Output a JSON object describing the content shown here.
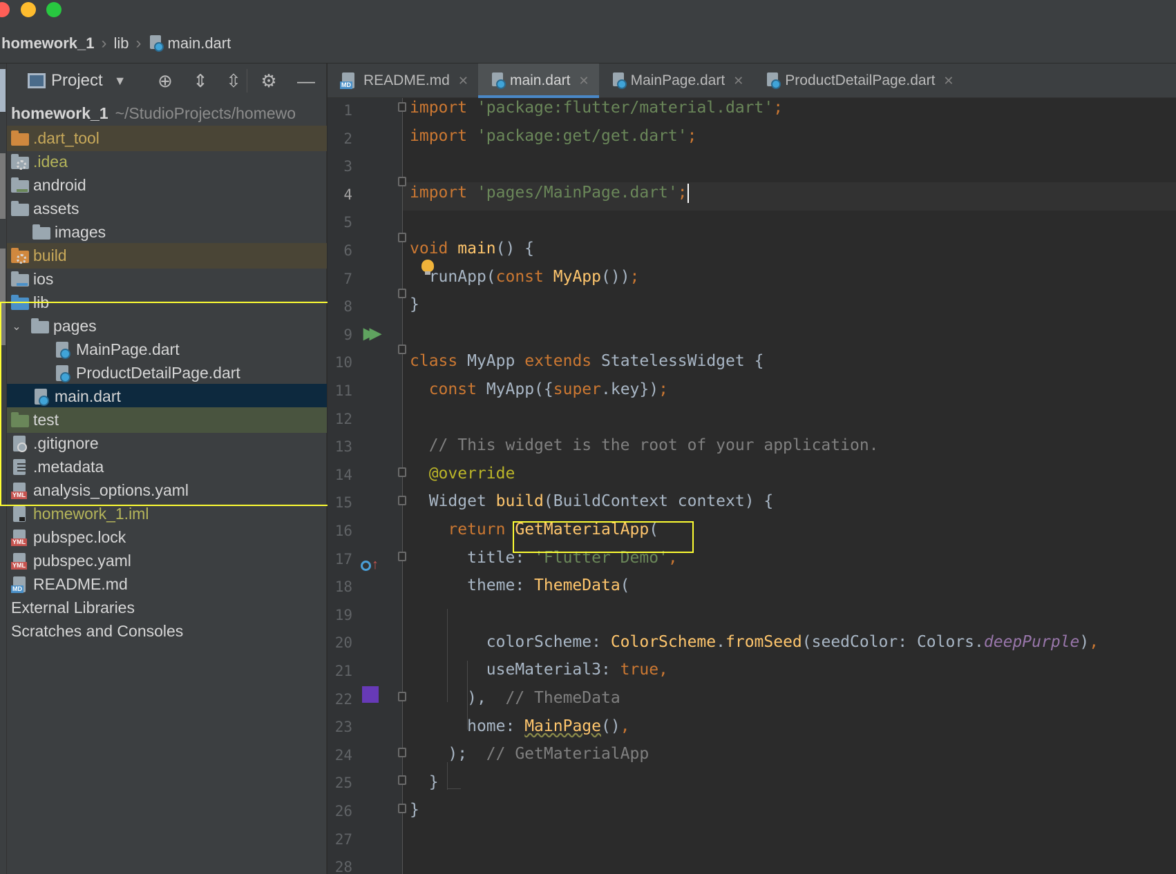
{
  "breadcrumb": {
    "project": "homework_1",
    "folder": "lib",
    "file": "main.dart"
  },
  "project_panel": {
    "title": "Project",
    "root_name": "homework_1",
    "root_path": "~/StudioProjects/homewo",
    "items": {
      "dart_tool": ".dart_tool",
      "idea": ".idea",
      "android": "android",
      "assets": "assets",
      "images": "images",
      "build": "build",
      "ios": "ios",
      "lib": "lib",
      "pages": "pages",
      "mainpage": "MainPage.dart",
      "productdetail": "ProductDetailPage.dart",
      "main": "main.dart",
      "test": "test",
      "gitignore": ".gitignore",
      "metadata": ".metadata",
      "analysis": "analysis_options.yaml",
      "iml": "homework_1.iml",
      "pubspec_lock": "pubspec.lock",
      "pubspec_yaml": "pubspec.yaml",
      "readme": "README.md",
      "external": "External Libraries",
      "scratches": "Scratches and Consoles"
    }
  },
  "tabs": [
    {
      "label": "README.md",
      "icon": "markdown-file-icon"
    },
    {
      "label": "main.dart",
      "icon": "dart-file-icon",
      "active": true
    },
    {
      "label": "MainPage.dart",
      "icon": "dart-file-icon"
    },
    {
      "label": "ProductDetailPage.dart",
      "icon": "dart-file-icon"
    }
  ],
  "editor": {
    "current_line": 4,
    "line_numbers": [
      "1",
      "2",
      "3",
      "4",
      "5",
      "6",
      "7",
      "8",
      "9",
      "10",
      "11",
      "12",
      "13",
      "14",
      "15",
      "16",
      "17",
      "18",
      "19",
      "20",
      "21",
      "22",
      "23",
      "24",
      "25",
      "26",
      "27",
      "28"
    ],
    "code": {
      "l1_kw": "import",
      "l1_str": "'package:flutter/material.dart'",
      "l1_semi": ";",
      "l2_kw": "import",
      "l2_str": "'package:get/get.dart'",
      "l2_semi": ";",
      "l4_kw": "import",
      "l4_str": "'pages/MainPage.dart'",
      "l4_semi": ";",
      "l6_kw": "void",
      "l6_fn": "main",
      "l6_rest": "() {",
      "l7_a": "runApp(",
      "l7_kw": "const",
      "l7_fn": "MyApp",
      "l7_b": "())",
      "l7_semi": ";",
      "l8": "}",
      "l10_kw1": "class",
      "l10_a": "MyApp",
      "l10_kw2": "extends",
      "l10_b": "StatelessWidget {",
      "l11_kw": "const",
      "l11_a": "MyApp({",
      "l11_kw2": "super",
      "l11_b": ".key})",
      "l11_semi": ";",
      "l13": "// This widget is the root of your application.",
      "l14": "@override",
      "l15_a": "Widget",
      "l15_fn": "build",
      "l15_b": "(BuildContext context) {",
      "l16_kw": "return",
      "l16_fn": "GetMaterialApp",
      "l16_b": "(",
      "l17_a": "title:",
      "l17_str": "'Flutter Demo'",
      "l17_comma": ",",
      "l18_a": "theme:",
      "l18_fn": "ThemeData",
      "l18_b": "(",
      "l20_a": "colorScheme:",
      "l20_fn1": "ColorScheme",
      "l20_dot": ".",
      "l20_fn2": "fromSeed",
      "l20_b": "(seedColor: Colors.",
      "l20_pur": "deepPurple",
      "l20_c": ")",
      "l20_comma": ",",
      "l21_a": "useMaterial3:",
      "l21_kw": "true",
      "l21_comma": ",",
      "l22_a": "),",
      "l22_cm": "// ThemeData",
      "l23_a": "home:",
      "l23_fn": "MainPage",
      "l23_b": "()",
      "l23_comma": ",",
      "l24_a": ");",
      "l24_cm": "// GetMaterialApp",
      "l25": "}",
      "l26": "}"
    },
    "swatch_color": "#673ab7"
  },
  "colors": {
    "keyword": "#cc7832",
    "string": "#6a8759",
    "function": "#ffc66d",
    "comment": "#808080",
    "annotation": "#bbb529",
    "highlight_box": "#ffff33",
    "selection": "#0d293e"
  }
}
